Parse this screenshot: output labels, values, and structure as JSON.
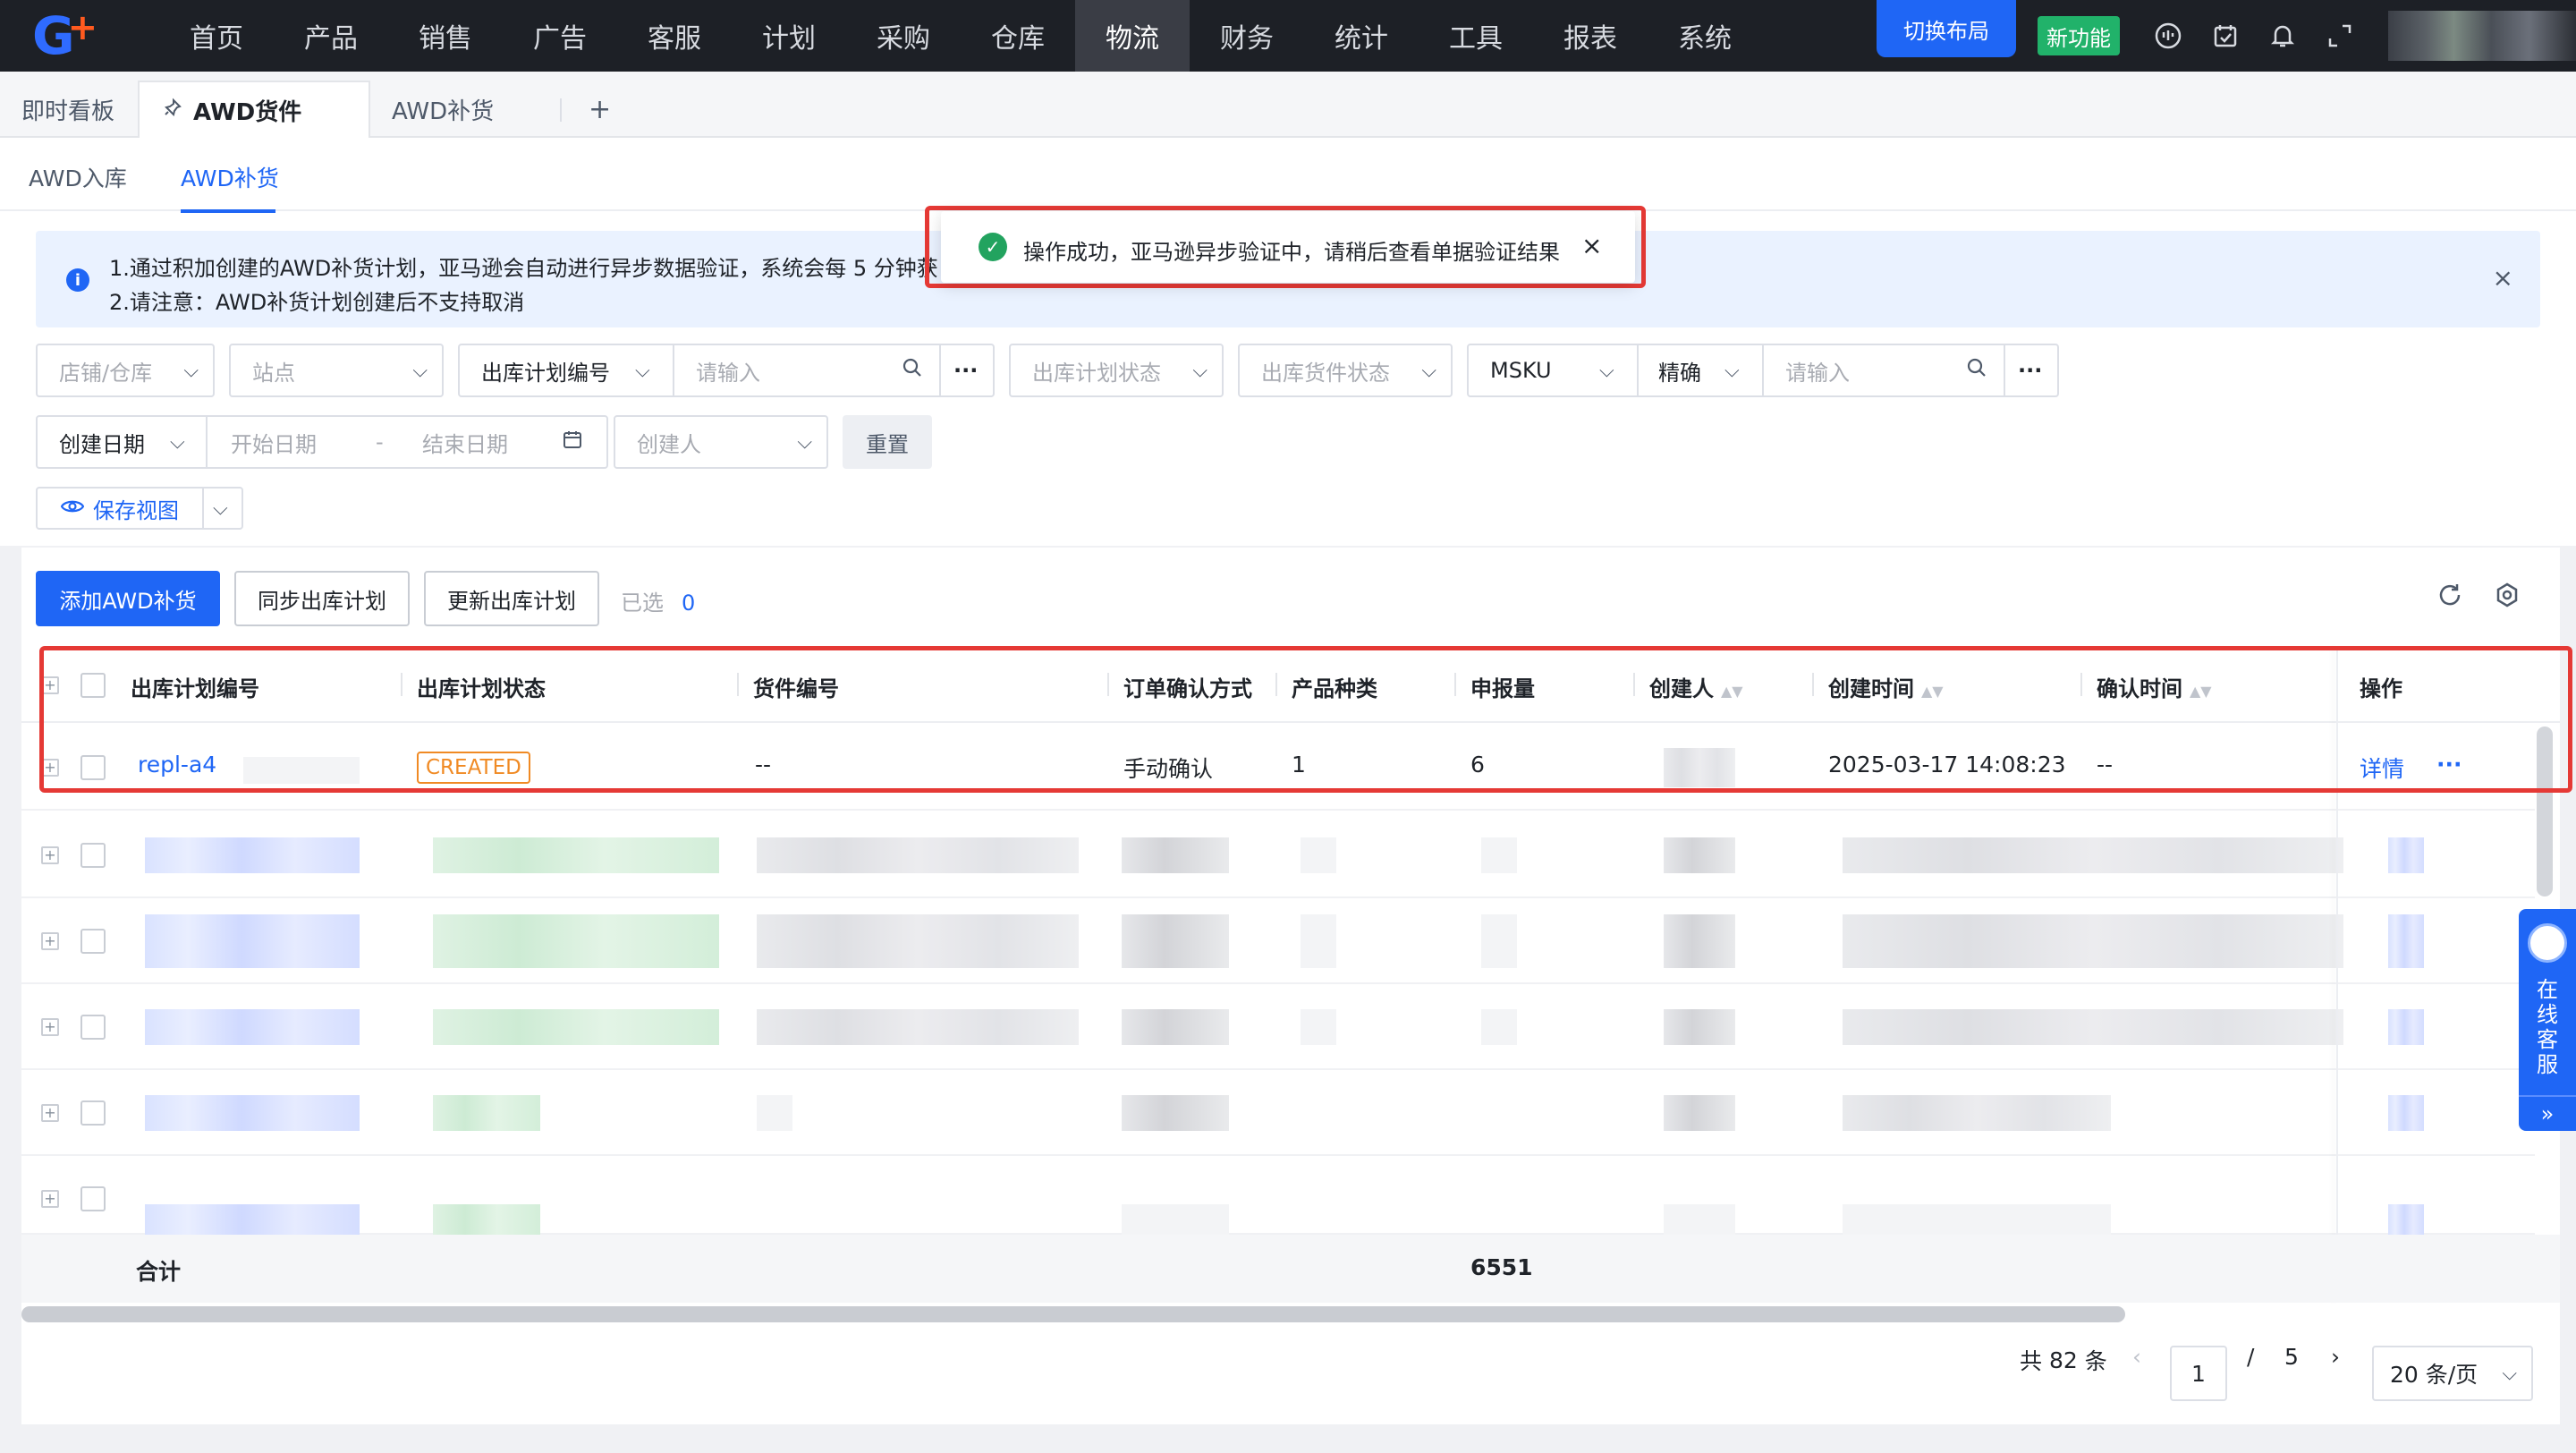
{
  "nav": {
    "logo_text": "G",
    "items": [
      "首页",
      "产品",
      "销售",
      "广告",
      "客服",
      "计划",
      "采购",
      "仓库",
      "物流",
      "财务",
      "统计",
      "工具",
      "报表",
      "系统"
    ],
    "active": "物流",
    "switch_layout": "切换布局",
    "new_feature": "新功能"
  },
  "page_tabs": {
    "tab1": "即时看板",
    "tab2": "AWD货件",
    "tab3": "AWD补货",
    "add": "+"
  },
  "sub_tabs": {
    "tab1": "AWD入库",
    "tab2": "AWD补货"
  },
  "alert": {
    "line1": "1.通过积加创建的AWD补货计划，亚马逊会自动进行异步数据验证，系统会每 5 分钟获",
    "line2": "2.请注意：AWD补货计划创建后不支持取消",
    "close": "×"
  },
  "toast": {
    "text": "操作成功，亚马逊异步验证中，请稍后查看单据验证结果",
    "close": "×"
  },
  "filters": {
    "shop": "店铺/仓库",
    "site": "站点",
    "plan_no": "出库计划编号",
    "search_placeholder": "请输入",
    "plan_status": "出库计划状态",
    "shipment_status": "出库货件状态",
    "msku": "MSKU",
    "exact": "精确",
    "search_placeholder2": "请输入",
    "date_type": "创建日期",
    "start_date": "开始日期",
    "date_sep": "-",
    "end_date": "结束日期",
    "creator": "创建人",
    "reset": "重置",
    "save_view": "保存视图"
  },
  "toolbar": {
    "add": "添加AWD补货",
    "sync": "同步出库计划",
    "update": "更新出库计划",
    "selected_label": "已选",
    "selected_count": "0"
  },
  "table": {
    "headers": {
      "plan_no": "出库计划编号",
      "plan_status": "出库计划状态",
      "shipment_no": "货件编号",
      "confirm_method": "订单确认方式",
      "product_types": "产品种类",
      "declared_qty": "申报量",
      "creator": "创建人",
      "created_at": "创建时间",
      "confirmed_at": "确认时间",
      "actions": "操作"
    },
    "row1": {
      "plan_no": "repl-a4",
      "status": "CREATED",
      "shipment_no": "--",
      "confirm_method": "手动确认",
      "product_types": "1",
      "declared_qty": "6",
      "created_at": "2025-03-17 14:08:23",
      "confirmed_at": "--",
      "detail": "详情",
      "more": "···"
    },
    "summary_label": "合计",
    "summary_qty": "6551"
  },
  "pagination": {
    "total_prefix": "共",
    "total": "82",
    "total_suffix": "条",
    "current": "1",
    "sep": "/",
    "pages": "5",
    "page_size": "20 条/页"
  },
  "customer_service": {
    "text": "在线客服"
  }
}
